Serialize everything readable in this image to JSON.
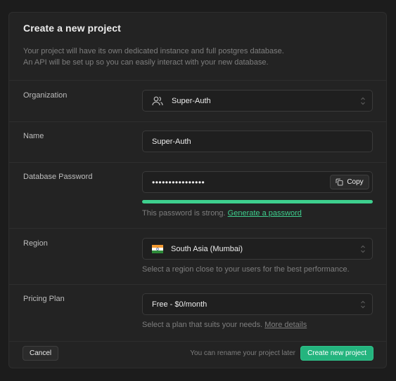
{
  "dialog": {
    "title": "Create a new project",
    "description_line1": "Your project will have its own dedicated instance and full postgres database.",
    "description_line2": "An API will be set up so you can easily interact with your new database."
  },
  "organization": {
    "label": "Organization",
    "value": "Super-Auth",
    "icon": "users-icon"
  },
  "name": {
    "label": "Name",
    "value": "Super-Auth"
  },
  "password": {
    "label": "Database Password",
    "value": "••••••••••••••••",
    "copy_label": "Copy",
    "strength_text": "This password is strong.",
    "generate_link": "Generate a password",
    "strength_fraction": 1.0,
    "strength_color": "#3ecf8e"
  },
  "region": {
    "label": "Region",
    "value": "South Asia (Mumbai)",
    "flag": "india-flag-icon",
    "hint": "Select a region close to your users for the best performance."
  },
  "pricing": {
    "label": "Pricing Plan",
    "value": "Free - $0/month",
    "hint": "Select a plan that suits your needs.",
    "details_link": "More details"
  },
  "footer": {
    "cancel_label": "Cancel",
    "rename_note": "You can rename your project later",
    "create_label": "Create new project"
  },
  "colors": {
    "accent": "#3ecf8e",
    "button_primary": "#24b47e",
    "background": "#1c1c1c",
    "panel": "#232323"
  }
}
